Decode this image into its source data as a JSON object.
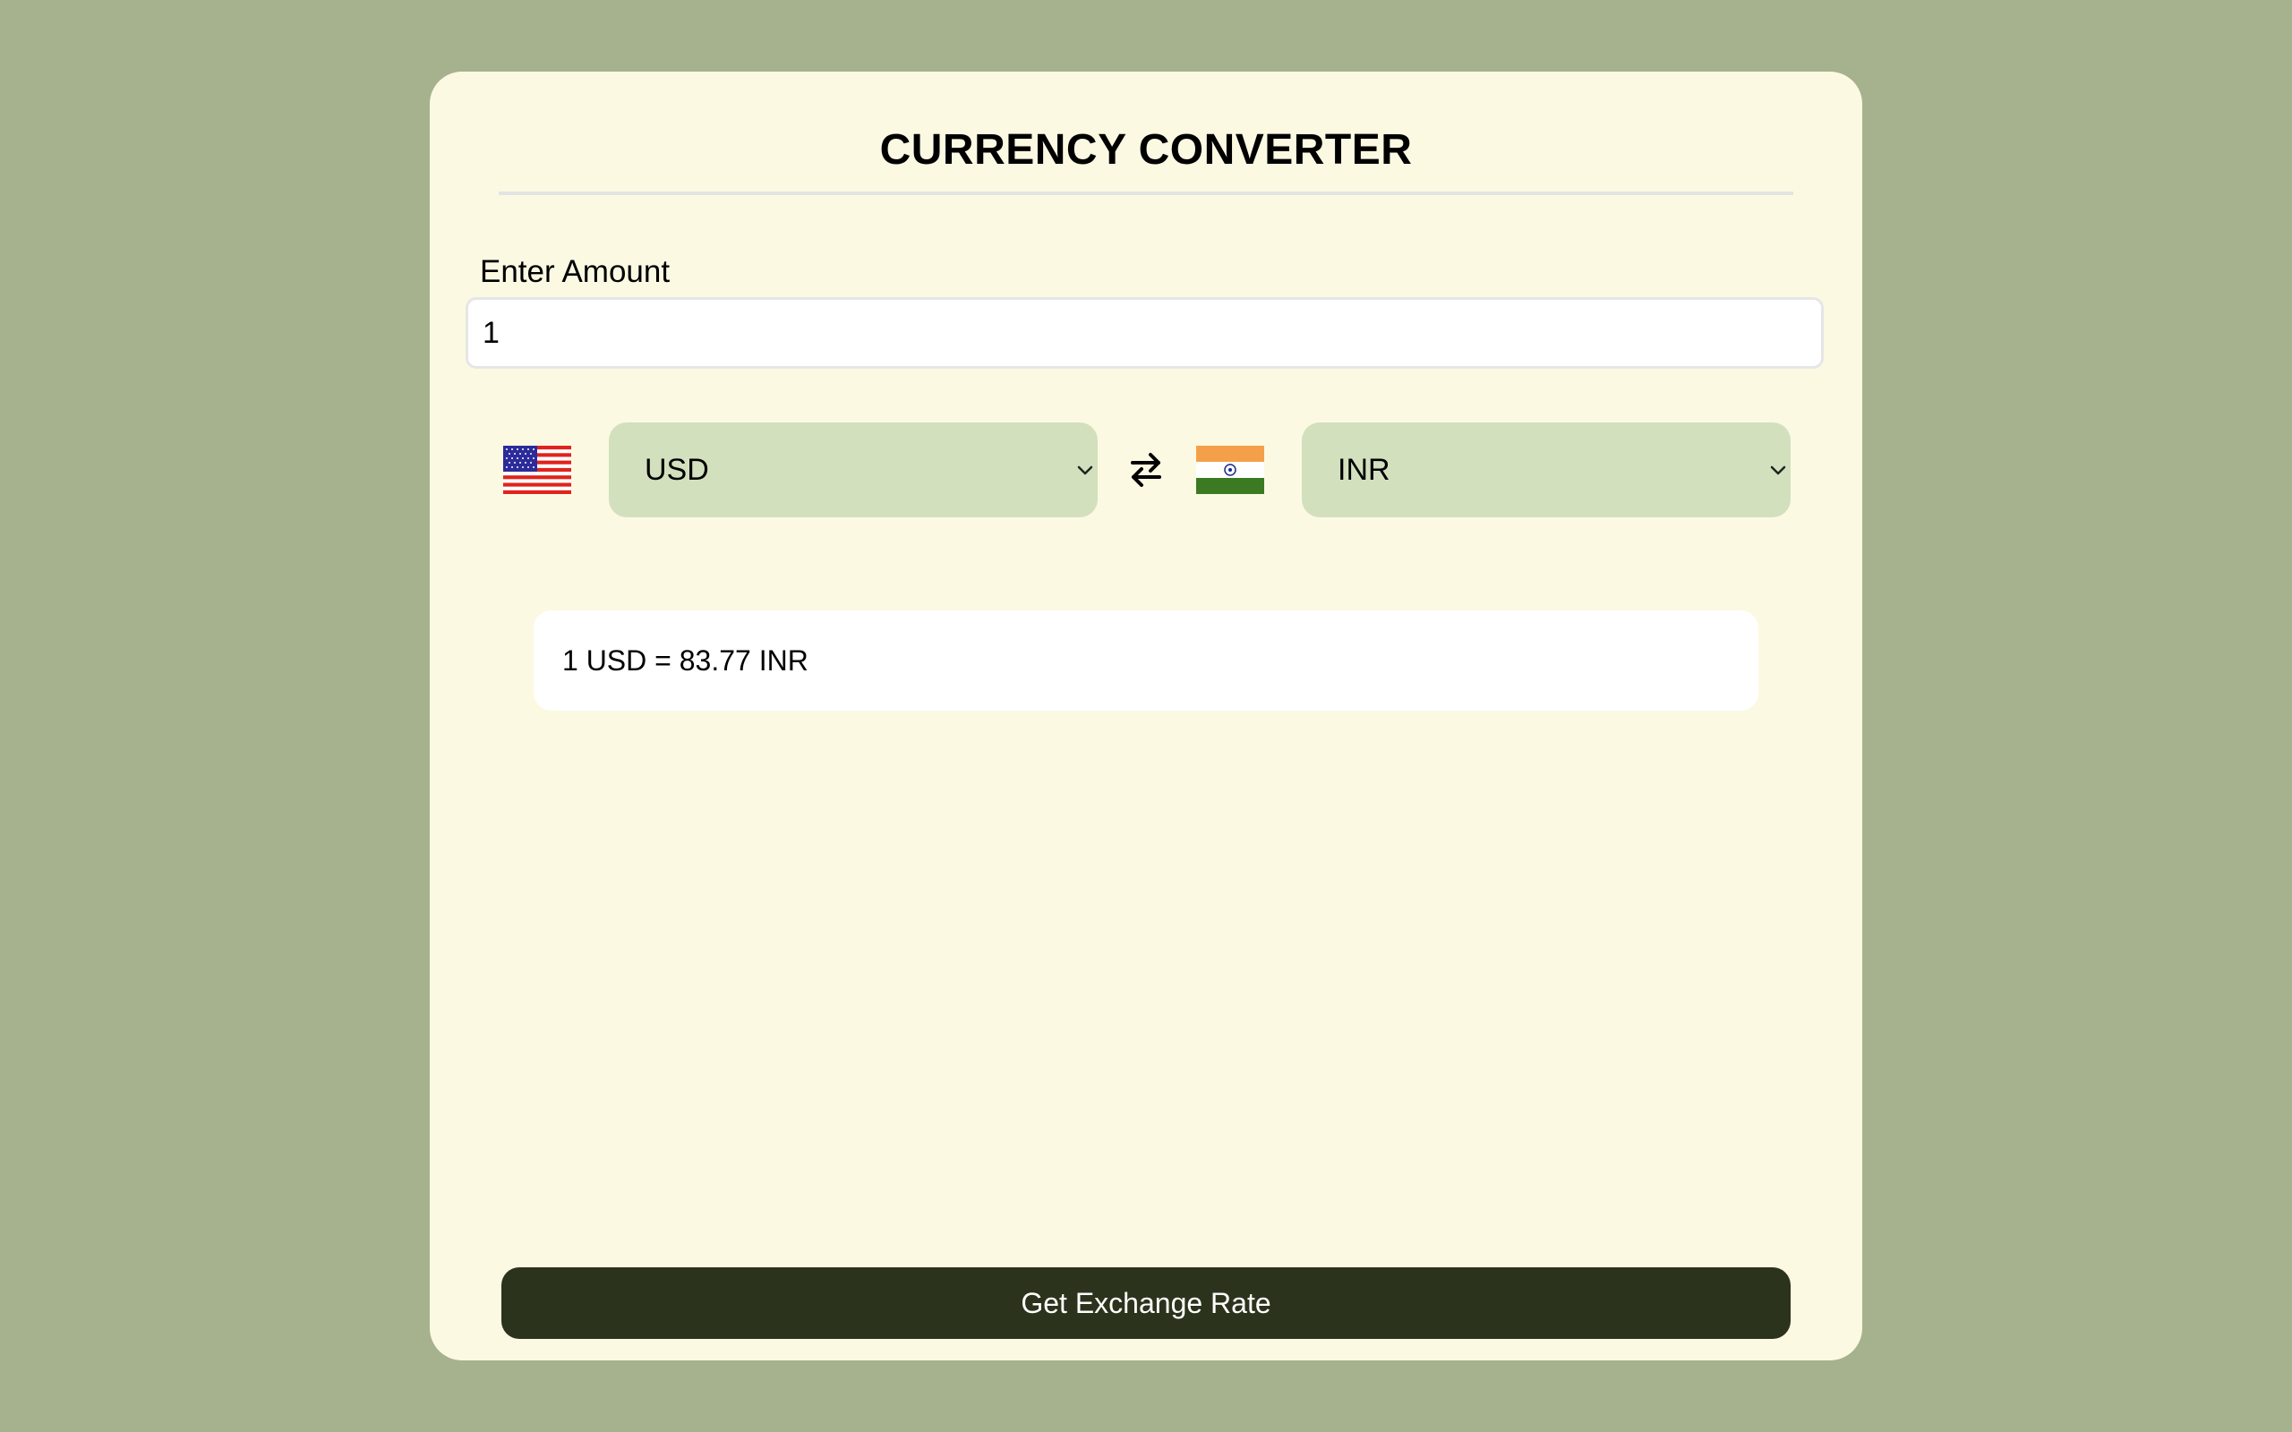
{
  "app": {
    "title": "CURRENCY CONVERTER"
  },
  "amount": {
    "label": "Enter Amount",
    "value": "1"
  },
  "from": {
    "currency": "USD",
    "flag_icon": "us-flag-icon"
  },
  "to": {
    "currency": "INR",
    "flag_icon": "india-flag-icon"
  },
  "swap": {
    "icon": "swap-arrows-icon"
  },
  "result": {
    "text": "1 USD = 83.77 INR"
  },
  "actions": {
    "get_rate_label": "Get Exchange Rate"
  },
  "colors": {
    "page_background": "#a5b28d",
    "card_background": "#fcf9e3",
    "select_background": "#d2e0bd",
    "button_background": "#2c331c",
    "button_text": "#ffffff"
  }
}
